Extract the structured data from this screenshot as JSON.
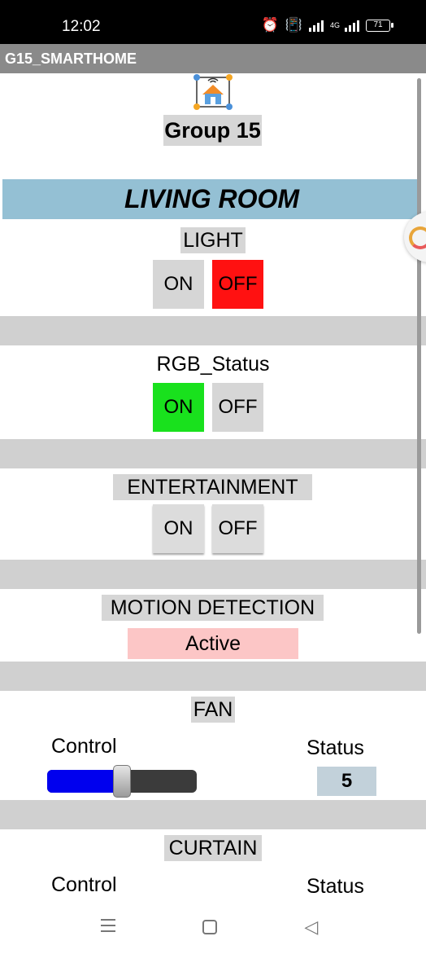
{
  "status_bar": {
    "time": "12:02",
    "network_label": "4G",
    "battery": "71"
  },
  "app": {
    "title": "G15_SMARTHOME"
  },
  "header": {
    "group_title": "Group 15"
  },
  "room": {
    "title": "LIVING ROOM"
  },
  "light": {
    "label": "LIGHT",
    "on_label": "ON",
    "off_label": "OFF",
    "state": "OFF"
  },
  "rgb": {
    "label": "RGB_Status",
    "on_label": "ON",
    "off_label": "OFF",
    "state": "ON"
  },
  "entertainment": {
    "label": "ENTERTAINMENT",
    "on_label": "ON",
    "off_label": "OFF"
  },
  "motion": {
    "label": "MOTION DETECTION",
    "status": "Active"
  },
  "fan": {
    "label": "FAN",
    "control_label": "Control",
    "status_label": "Status",
    "status_value": "5",
    "slider_fraction": 0.5
  },
  "curtain": {
    "label": "CURTAIN",
    "control_label": "Control",
    "status_label": "Status"
  },
  "colors": {
    "title_bar": "#8a8a8a",
    "room_banner": "#94c0d4",
    "off_active": "#ff1111",
    "on_active": "#19e11d",
    "slider_fill": "#0000ee",
    "motion_box": "#fcc6c6",
    "status_box": "#c2d1da"
  },
  "icons": {
    "alarm": "alarm-icon",
    "vibrate": "vibrate-icon",
    "signal": "signal-icon",
    "battery": "battery-icon",
    "logo": "smart-home-icon",
    "nav_menu": "menu-icon",
    "nav_home": "home-square-icon",
    "nav_back": "back-triangle-icon"
  }
}
